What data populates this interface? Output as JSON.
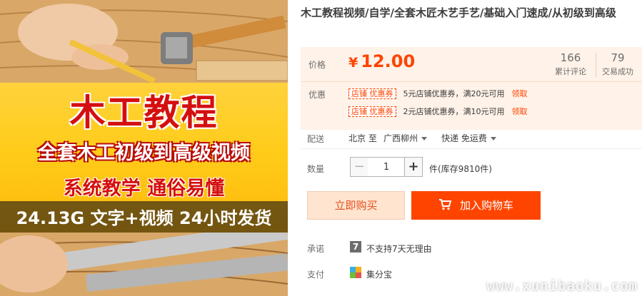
{
  "product_image": {
    "line1": "木工教程",
    "line2": "全套木工初级到高级视频",
    "line3": "系统教学  通俗易懂",
    "line4": "24.13G 文字+视频 24小时发货"
  },
  "title": "木工教程视频/自学/全套木匠木艺手艺/基础入门速成/从初级到高级",
  "price": {
    "label": "价格",
    "currency": "¥",
    "amount": "12.00",
    "reviews_count": "166",
    "reviews_label": "累计评论",
    "sold_count": "79",
    "sold_label": "交易成功"
  },
  "promo": {
    "label": "优惠",
    "coupons": [
      {
        "tag": "店铺 优惠券",
        "desc": "5元店铺优惠券，满20元可用",
        "claim": "领取"
      },
      {
        "tag": "店铺 优惠券",
        "desc": "2元店铺优惠券，满10元可用",
        "claim": "领取"
      }
    ]
  },
  "shipping": {
    "label": "配送",
    "from": "北京 至",
    "to": "广西柳州",
    "method": "快递 免运费"
  },
  "quantity": {
    "label": "数量",
    "minus": "−",
    "value": "1",
    "plus": "+",
    "stock": "件(库存9810件)"
  },
  "actions": {
    "buy_now": "立即购买",
    "add_to_cart": "加入购物车"
  },
  "promise": {
    "label": "承诺",
    "icon_text": "7",
    "text": "不支持7天无理由"
  },
  "payment": {
    "label": "支付",
    "text": "集分宝"
  },
  "watermark": "www.xunibaoku.com",
  "colors": {
    "accent": "#ff4400",
    "price_bg": "#fff2e8",
    "banner_yellow": "#ffcc1a",
    "banner_red": "#d40f0f"
  }
}
